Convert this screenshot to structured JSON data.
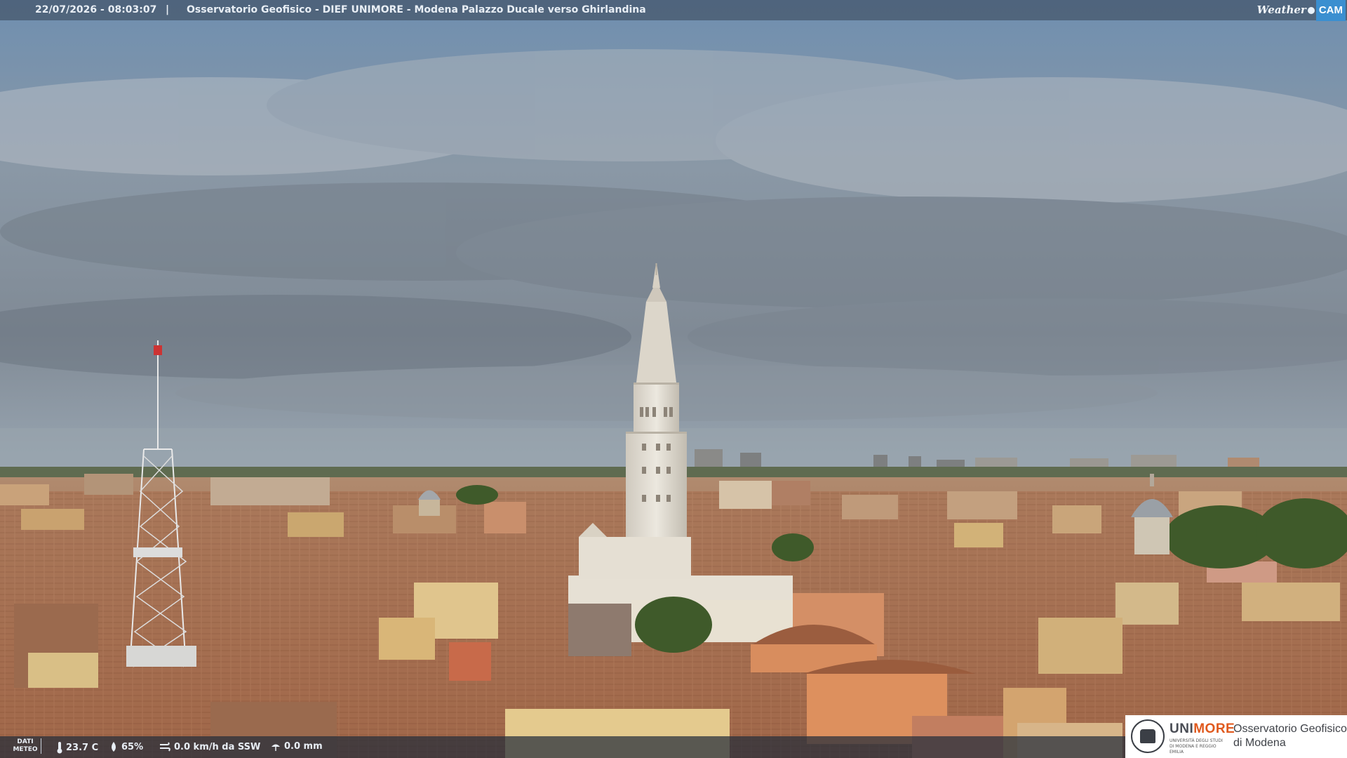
{
  "overlay": {
    "timestamp": "22/07/2026 - 08:03:07",
    "separator": "|",
    "title": "Osservatorio Geofisico - DIEF UNIMORE - Modena Palazzo Ducale verso Ghirlandina",
    "brand_weather": "Weather",
    "brand_cam": "CAM"
  },
  "meteo": {
    "label_line1": "DATI",
    "label_line2": "METEO",
    "temperature": "23.7 C",
    "humidity": "65%",
    "wind": "0.0 km/h da SSW",
    "rain": "0.0 mm"
  },
  "logo": {
    "uni": "UNI",
    "more": "MORE",
    "subtitle": "UNIVERSITÀ DEGLI STUDI DI MODENA E REGGIO EMILIA",
    "observatory_line1": "Osservatorio Geofisico",
    "observatory_line2": "di Modena"
  },
  "colors": {
    "sky_top": "#6f8fb0",
    "clouds": "#8e9aa6",
    "roofs": "#a86d4d",
    "tower": "#e2ddd2",
    "unimore_orange": "#e05a1e"
  },
  "icons": [
    "thermometer-icon",
    "humidity-drop-icon",
    "wind-icon",
    "rain-icon",
    "unimore-seal-icon"
  ]
}
